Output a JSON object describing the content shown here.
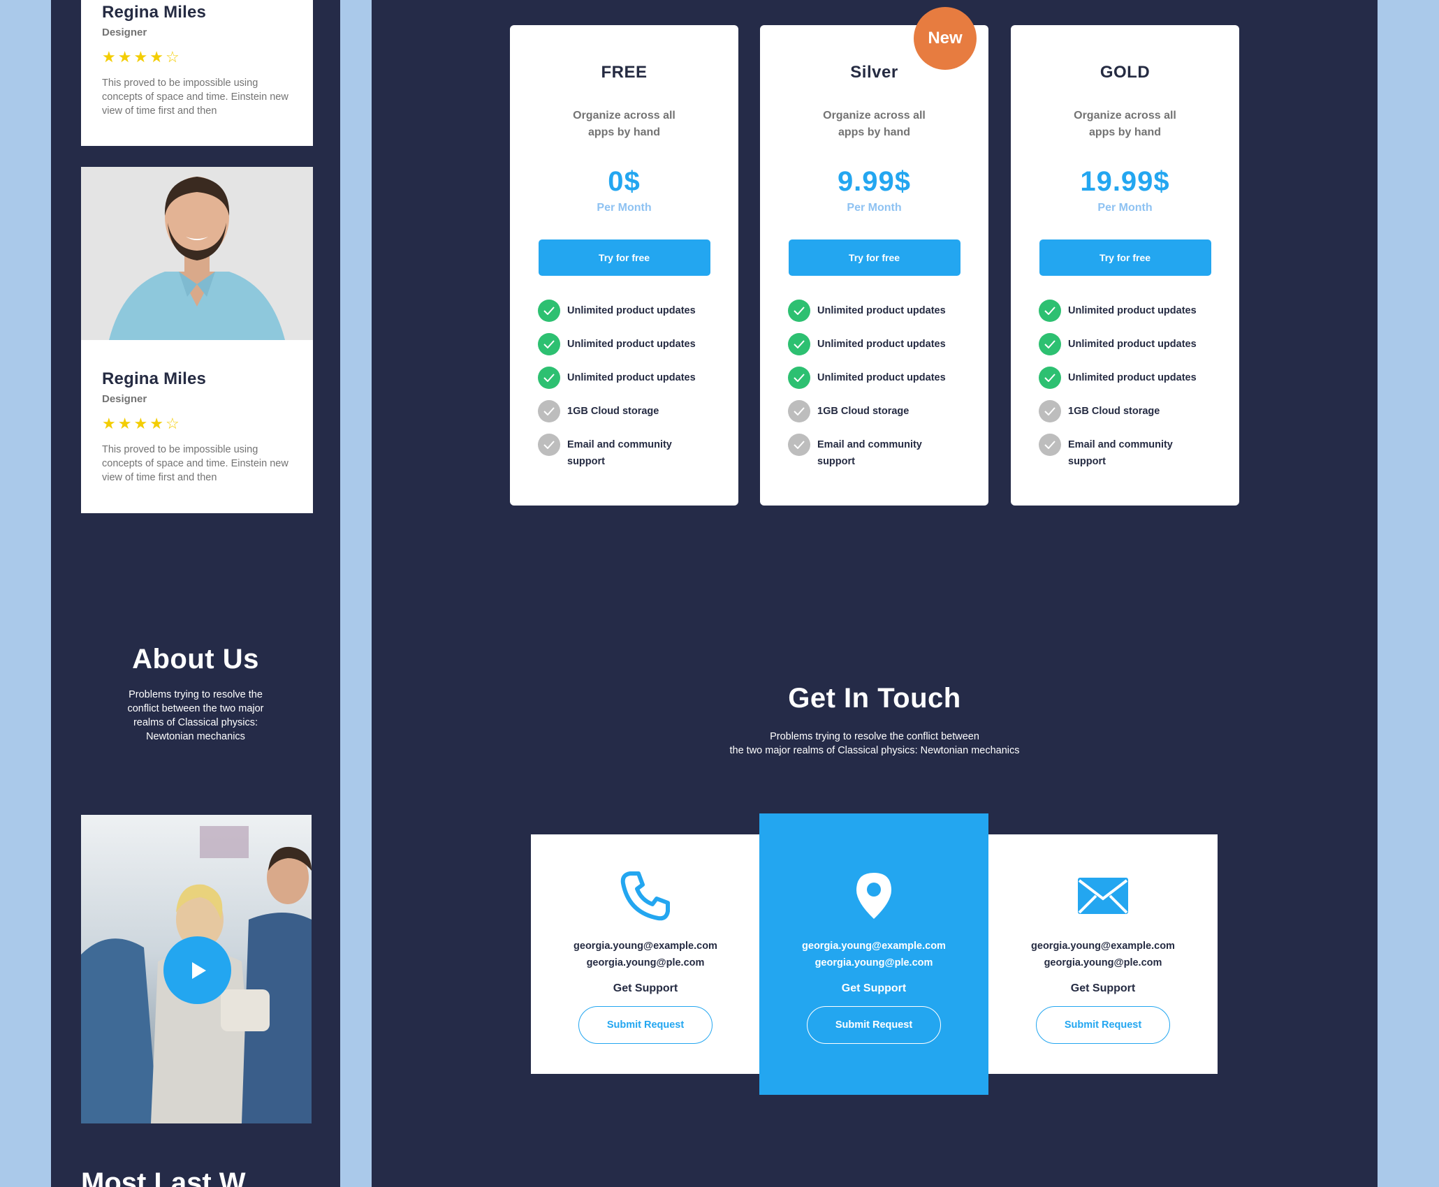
{
  "reviews": [
    {
      "name": "Regina Miles",
      "role": "Designer",
      "rating": 4,
      "max_rating": 5,
      "text": "This proved to be impossible using concepts of space and time. Einstein new view of time first and then"
    },
    {
      "name": "Regina Miles",
      "role": "Designer",
      "rating": 4,
      "max_rating": 5,
      "text": "This proved to be impossible using concepts of space and time. Einstein new view of time first and then"
    }
  ],
  "about": {
    "title": "About Us",
    "text": "Problems trying to resolve the conflict between the two major realms of Classical physics: Newtonian mechanics"
  },
  "mobile_bottom_heading": "Most Last W...",
  "pricing": {
    "badge": "New",
    "plans": [
      {
        "title": "FREE",
        "description": "Organize across all apps by hand",
        "price": "0$",
        "period": "Per Month",
        "button": "Try for free",
        "features": [
          {
            "text": "Unlimited product updates",
            "included": true
          },
          {
            "text": "Unlimited product updates",
            "included": true
          },
          {
            "text": "Unlimited product updates",
            "included": true
          },
          {
            "text": "1GB  Cloud storage",
            "included": false
          },
          {
            "text": "Email and community support",
            "included": false
          }
        ]
      },
      {
        "title": "Silver",
        "description": "Organize across all apps by hand",
        "price": "9.99$",
        "period": "Per Month",
        "button": "Try for free",
        "features": [
          {
            "text": "Unlimited product updates",
            "included": true
          },
          {
            "text": "Unlimited product updates",
            "included": true
          },
          {
            "text": "Unlimited product updates",
            "included": true
          },
          {
            "text": "1GB  Cloud storage",
            "included": false
          },
          {
            "text": "Email and community support",
            "included": false
          }
        ]
      },
      {
        "title": "GOLD",
        "description": "Organize across all apps by hand",
        "price": "19.99$",
        "period": "Per Month",
        "button": "Try for free",
        "features": [
          {
            "text": "Unlimited product updates",
            "included": true
          },
          {
            "text": "Unlimited product updates",
            "included": true
          },
          {
            "text": "Unlimited product updates",
            "included": true
          },
          {
            "text": "1GB  Cloud storage",
            "included": false
          },
          {
            "text": "Email and community support",
            "included": false
          }
        ]
      }
    ]
  },
  "contact": {
    "title": "Get In Touch",
    "text_line1": "Problems trying to resolve the conflict between",
    "text_line2": "the two major realms of Classical physics: Newtonian mechanics",
    "cards": [
      {
        "icon": "phone-icon",
        "email1": "georgia.young@example.com",
        "email2": "georgia.young@ple.com",
        "label": "Get Support",
        "button": "Submit Request"
      },
      {
        "icon": "location-pin-icon",
        "email1": "georgia.young@example.com",
        "email2": "georgia.young@ple.com",
        "label": "Get Support",
        "button": "Submit Request"
      },
      {
        "icon": "envelope-icon",
        "email1": "georgia.young@example.com",
        "email2": "georgia.young@ple.com",
        "label": "Get Support",
        "button": "Submit Request"
      }
    ]
  },
  "colors": {
    "primary": "#23a6f0",
    "dark_bg": "#252b48",
    "page_bg": "#aac9ea",
    "success": "#2dc071",
    "muted": "#bdbdbd",
    "badge": "#e77c40",
    "star": "#f3cd03"
  }
}
